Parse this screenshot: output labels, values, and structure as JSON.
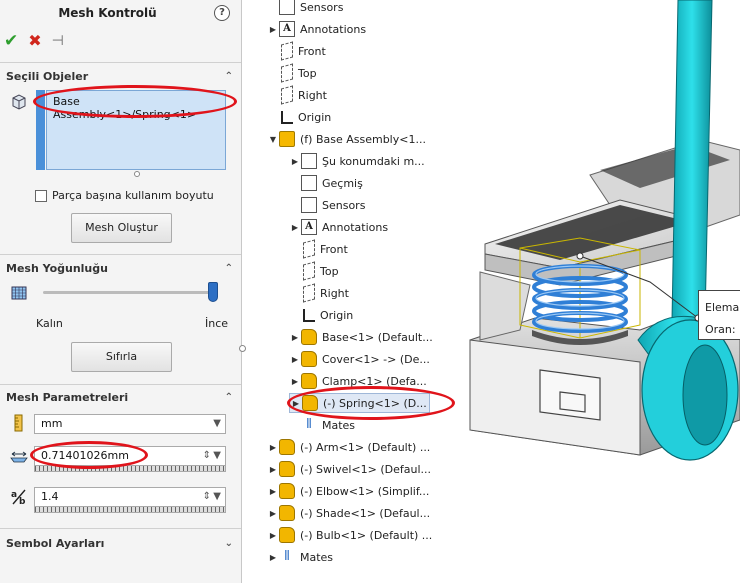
{
  "panel": {
    "title": "Mesh Kontrolü",
    "help": "?",
    "sections": {
      "selected": {
        "title": "Seçili Objeler",
        "selection": "Base Assembly<1>/Spring<1>",
        "per_part_label": "Parça başına kullanım boyutu",
        "create_button": "Mesh Oluştur"
      },
      "density": {
        "title": "Mesh Yoğunluğu",
        "coarse_label": "Kalın",
        "fine_label": "İnce",
        "slider_value_pct": 97,
        "reset_button": "Sıfırla"
      },
      "params": {
        "title": "Mesh Parametreleri",
        "unit": "mm",
        "element_size": "0.71401026mm",
        "ratio": "1.4"
      },
      "symbol": {
        "title": "Sembol Ayarları"
      }
    }
  },
  "tree": {
    "items": [
      {
        "label": "Sensors",
        "icon": "sensors-icon",
        "indent": 1,
        "arrow": ""
      },
      {
        "label": "Annotations",
        "icon": "annotations-icon",
        "indent": 1,
        "arrow": "▶"
      },
      {
        "label": "Front",
        "icon": "plane-icon",
        "indent": 1,
        "arrow": ""
      },
      {
        "label": "Top",
        "icon": "plane-icon",
        "indent": 1,
        "arrow": ""
      },
      {
        "label": "Right",
        "icon": "plane-icon",
        "indent": 1,
        "arrow": ""
      },
      {
        "label": "Origin",
        "icon": "origin-icon",
        "indent": 1,
        "arrow": ""
      },
      {
        "label": "(f) Base Assembly<1...",
        "icon": "assembly-icon",
        "indent": 1,
        "arrow": "▼"
      },
      {
        "label": "Şu konumdaki m...",
        "icon": "history-icon",
        "indent": 2,
        "arrow": "▶"
      },
      {
        "label": "Geçmiş",
        "icon": "history-icon",
        "indent": 2,
        "arrow": ""
      },
      {
        "label": "Sensors",
        "icon": "sensors-icon",
        "indent": 2,
        "arrow": ""
      },
      {
        "label": "Annotations",
        "icon": "annotations-icon",
        "indent": 2,
        "arrow": "▶"
      },
      {
        "label": "Front",
        "icon": "plane-icon",
        "indent": 2,
        "arrow": ""
      },
      {
        "label": "Top",
        "icon": "plane-icon",
        "indent": 2,
        "arrow": ""
      },
      {
        "label": "Right",
        "icon": "plane-icon",
        "indent": 2,
        "arrow": ""
      },
      {
        "label": "Origin",
        "icon": "origin-icon",
        "indent": 2,
        "arrow": ""
      },
      {
        "label": "Base<1> (Default...",
        "icon": "part-icon",
        "indent": 2,
        "arrow": "▶"
      },
      {
        "label": "Cover<1> -> (De...",
        "icon": "part-icon",
        "indent": 2,
        "arrow": "▶"
      },
      {
        "label": "Clamp<1> (Defa...",
        "icon": "part-icon",
        "indent": 2,
        "arrow": "▶"
      },
      {
        "label": "(-) Spring<1> (D...",
        "icon": "part-icon",
        "indent": 2,
        "arrow": "▶",
        "selected": true
      },
      {
        "label": "Mates",
        "icon": "mates-icon",
        "indent": 2,
        "arrow": ""
      },
      {
        "label": "(-) Arm<1> (Default) ...",
        "icon": "part-icon",
        "indent": 1,
        "arrow": "▶"
      },
      {
        "label": "(-) Swivel<1> (Defaul...",
        "icon": "part-icon",
        "indent": 1,
        "arrow": "▶"
      },
      {
        "label": "(-) Elbow<1> (Simplif...",
        "icon": "part-icon",
        "indent": 1,
        "arrow": "▶"
      },
      {
        "label": "(-) Shade<1> (Defaul...",
        "icon": "part-icon",
        "indent": 1,
        "arrow": "▶"
      },
      {
        "label": "(-) Bulb<1> (Default) ...",
        "icon": "part-icon",
        "indent": 1,
        "arrow": "▶"
      },
      {
        "label": "Mates",
        "icon": "mates-icon",
        "indent": 1,
        "arrow": "▶"
      }
    ]
  },
  "viewport": {
    "callout_line1": "Elemar",
    "callout_line2": "Oran:"
  },
  "colors": {
    "highlight_red": "#e0141b",
    "selection_blue": "#cfe3f7",
    "arm_cyan": "#19c9d6"
  }
}
